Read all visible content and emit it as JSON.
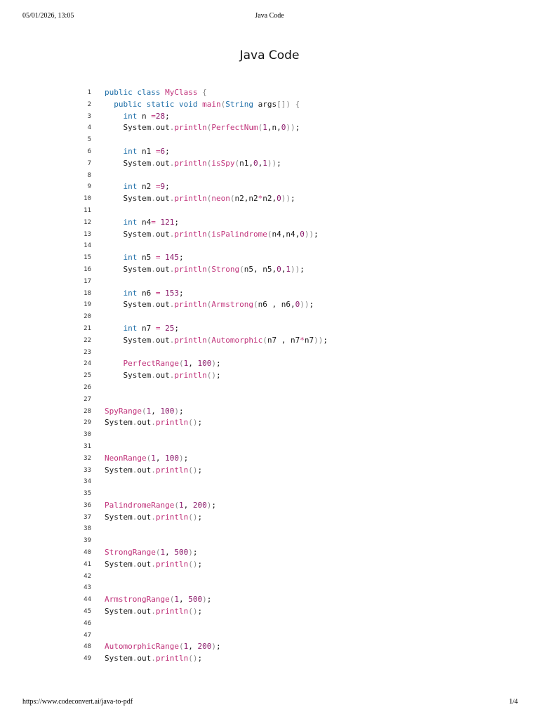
{
  "header": {
    "datetime": "05/01/2026, 13:05",
    "title": "Java Code"
  },
  "document": {
    "title": "Java Code"
  },
  "footer": {
    "url": "https://www.codeconvert.ai/java-to-pdf",
    "page": "1/4"
  },
  "colors": {
    "keyword": "#1f6fa8",
    "function": "#c0327a",
    "number": "#8a1a6a",
    "punctuation": "#888888",
    "plain": "#1a1a1a"
  },
  "code_lines": [
    "public class MyClass {",
    "  public static void main(String args[]) {",
    "    int n =28;",
    "    System.out.println(PerfectNum(1,n,0));",
    "",
    "    int n1 =6;",
    "    System.out.println(isSpy(n1,0,1));",
    "",
    "    int n2 =9;",
    "    System.out.println(neon(n2,n2*n2,0));",
    "",
    "    int n4= 121;",
    "    System.out.println(isPalindrome(n4,n4,0));",
    "",
    "    int n5 = 145;",
    "    System.out.println(Strong(n5, n5,0,1));",
    "",
    "    int n6 = 153;",
    "    System.out.println(Armstrong(n6 , n6,0));",
    "",
    "    int n7 = 25;",
    "    System.out.println(Automorphic(n7 , n7*n7));",
    "",
    "    PerfectRange(1, 100);",
    "    System.out.println();",
    "",
    "",
    "SpyRange(1, 100);",
    "System.out.println();",
    "",
    "",
    "NeonRange(1, 100);",
    "System.out.println();",
    "",
    "",
    "PalindromeRange(1, 200);",
    "System.out.println();",
    "",
    "",
    "StrongRange(1, 500);",
    "System.out.println();",
    "",
    "",
    "ArmstrongRange(1, 500);",
    "System.out.println();",
    "",
    "",
    "AutomorphicRange(1, 200);",
    "System.out.println();"
  ]
}
